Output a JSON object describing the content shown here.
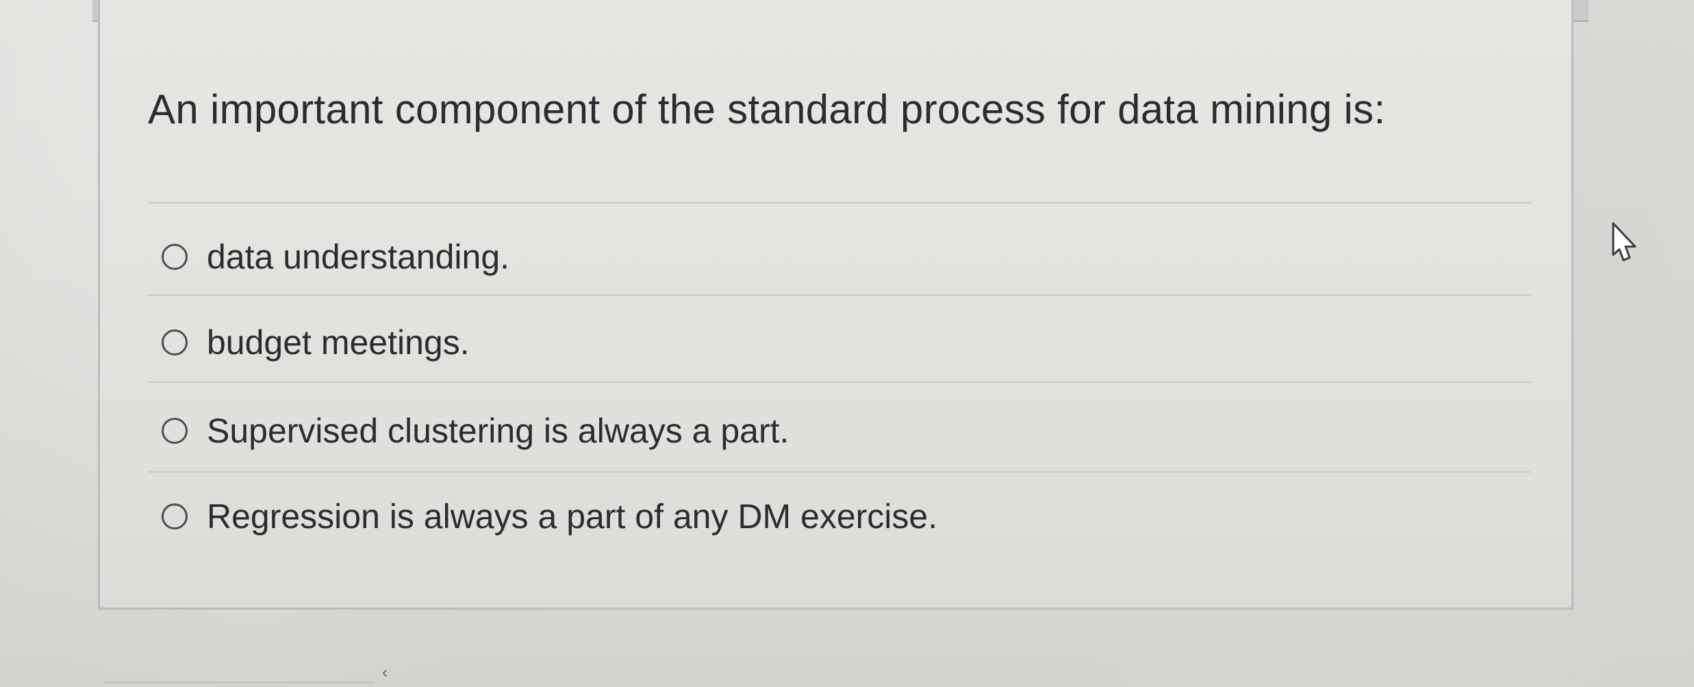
{
  "question": {
    "text": "An important component of the standard process for data mining is:"
  },
  "options": [
    {
      "label": "data understanding.",
      "selected": false
    },
    {
      "label": "budget meetings.",
      "selected": false
    },
    {
      "label": "Supervised clustering is always a part.",
      "selected": false
    },
    {
      "label": "Regression is always a part of any DM exercise.",
      "selected": false
    }
  ],
  "icons": {
    "cursor": "pointer-hand-icon"
  },
  "colors": {
    "text": "#2a2c31",
    "border": "#b7bcc2",
    "radio": "#4a4d52"
  }
}
